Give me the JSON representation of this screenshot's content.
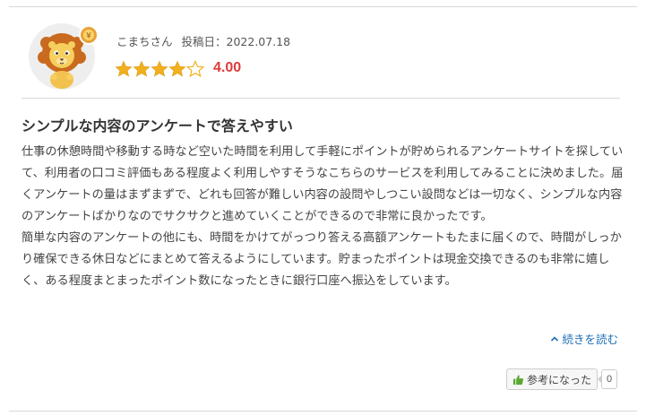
{
  "review": {
    "author": "こまちさん",
    "date_label": "投稿日：2022.07.18",
    "rating": 4.0,
    "rating_text": "4.00",
    "stars_total": 5,
    "title": "シンプルな内容のアンケートで答えやすい",
    "paragraphs": [
      "仕事の休憩時間や移動する時など空いた時間を利用して手軽にポイントが貯められるアンケートサイトを探していて、利用者の口コミ評価もある程度よく利用しやすそうなこちらのサービスを利用してみることに決めました。届くアンケートの量はまずまずで、どれも回答が難しい内容の設問やしつこい設問などは一切なく、シンプルな内容のアンケートばかりなのでサクサクと進めていくことができるので非常に良かったです。",
      "簡単な内容のアンケートの他にも、時間をかけてがっつり答える高額アンケートもたまに届くので、時間がしっかり確保できる休日などにまとめて答えるようにしています。貯まったポイントは現金交換できるのも非常に嬉しく、ある程度まとまったポイント数になったときに銀行口座へ振込をしています。"
    ],
    "read_more": "続きを読む",
    "helpful_label": "参考になった",
    "helpful_count": "0"
  },
  "colors": {
    "star": "#f2b01e",
    "rating": "#e03a3a",
    "link": "#1f6fb5",
    "thumb": "#5aa832"
  },
  "icons": {
    "avatar": "lion-avatar",
    "badge": "coin-badge-icon",
    "read_more": "chevron-up-icon",
    "helpful": "thumbs-up-icon"
  }
}
